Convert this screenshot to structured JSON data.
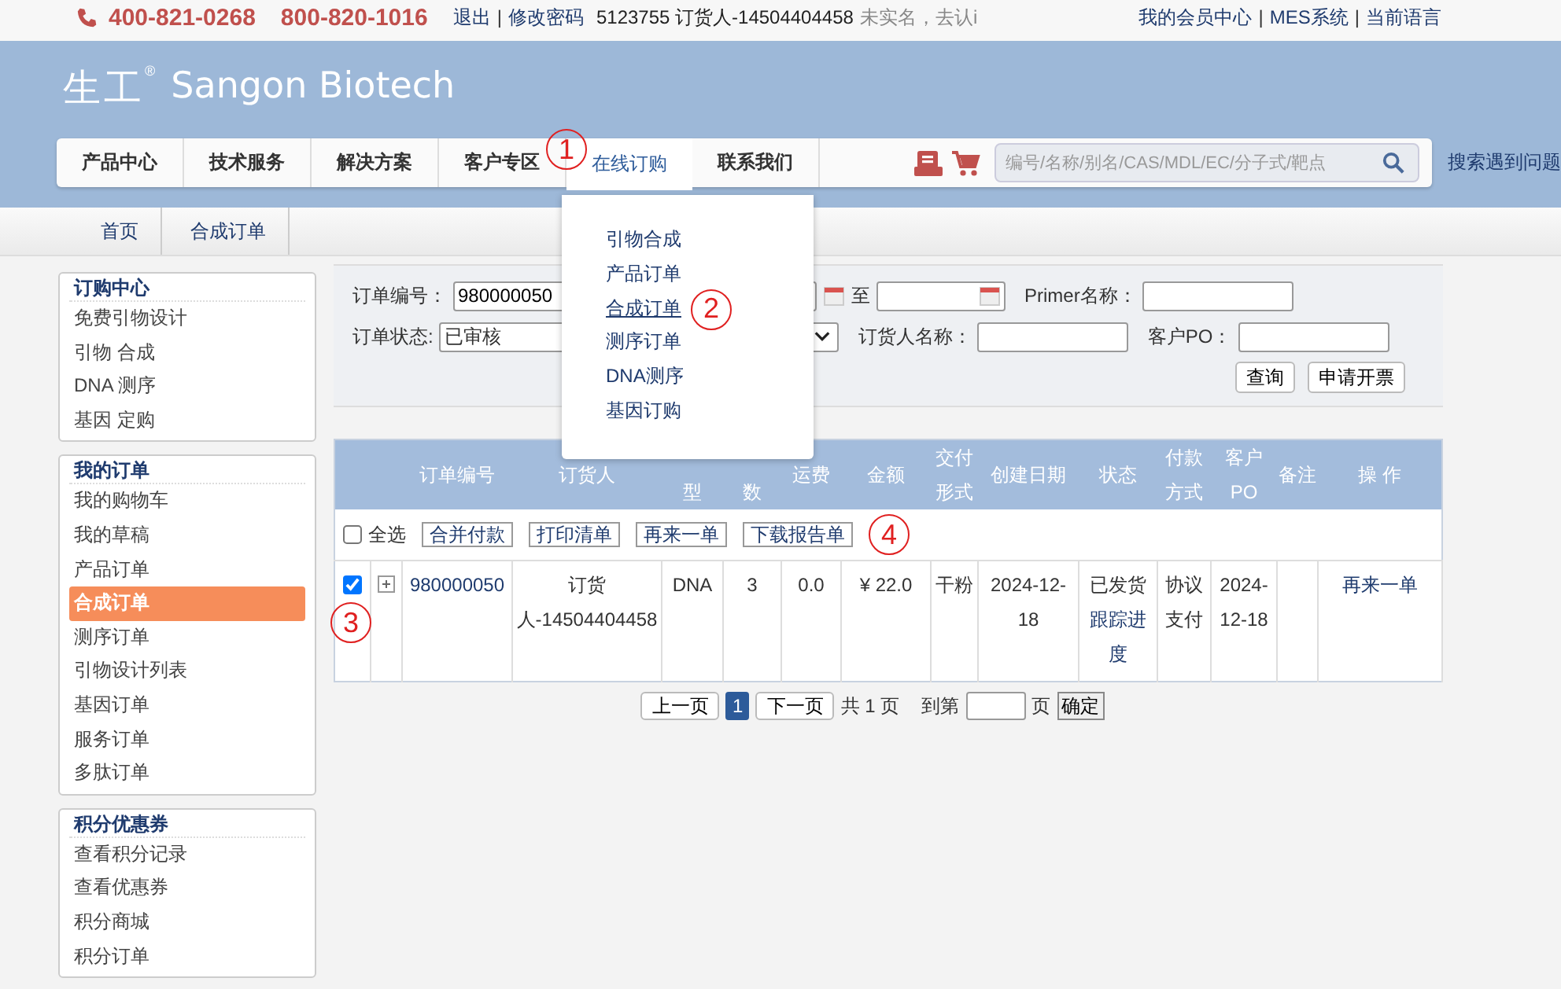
{
  "top_bar": {
    "phones": [
      "400-821-0268",
      "800-820-1016"
    ],
    "links": [
      "退出",
      "修改密码"
    ],
    "account": "5123755 订货人-14504404458",
    "notice": "未实名，去认i",
    "separator": "|",
    "right_links": [
      "我的会员中心",
      "MES系统",
      "当前语言"
    ]
  },
  "logo": {
    "mark": "生工",
    "registered": "®",
    "brand": "Sangon Biotech"
  },
  "nav": {
    "items": [
      {
        "label": "产品中心",
        "selected": false
      },
      {
        "label": "技术服务",
        "selected": false
      },
      {
        "label": "解决方案",
        "selected": false
      },
      {
        "label": "客户专区",
        "selected": false
      },
      {
        "label": "在线订购",
        "selected": true,
        "annotation": "1"
      },
      {
        "label": "联系我们",
        "selected": false
      }
    ],
    "search": {
      "placeholder": "编号/名称/别名/CAS/MDL/EC/分子式/靶点"
    },
    "help_link": "搜索遇到问题"
  },
  "dropdown": {
    "items": [
      {
        "label": "引物合成",
        "selected": false
      },
      {
        "label": "产品订单",
        "selected": false
      },
      {
        "label": "合成订单",
        "selected": true,
        "annotation": "2"
      },
      {
        "label": "测序订单",
        "selected": false
      },
      {
        "label": "DNA测序",
        "selected": false
      },
      {
        "label": "基因订购",
        "selected": false
      }
    ]
  },
  "breadcrumb": [
    "首页",
    "合成订单"
  ],
  "sidebar": {
    "sections": [
      {
        "title": "订购中心",
        "items": [
          {
            "label": "免费引物设计",
            "selected": false
          },
          {
            "label": "引物  合成",
            "selected": false
          },
          {
            "label": "DNA 测序",
            "selected": false
          },
          {
            "label": "基因  定购",
            "selected": false
          }
        ]
      },
      {
        "title": "我的订单",
        "items": [
          {
            "label": "我的购物车",
            "selected": false
          },
          {
            "label": "我的草稿",
            "selected": false
          },
          {
            "label": "产品订单",
            "selected": false
          },
          {
            "label": "合成订单",
            "selected": true
          },
          {
            "label": "测序订单",
            "selected": false
          },
          {
            "label": "引物设计列表",
            "selected": false
          },
          {
            "label": "基因订单",
            "selected": false
          },
          {
            "label": "服务订单",
            "selected": false
          },
          {
            "label": "多肽订单",
            "selected": false
          }
        ]
      },
      {
        "title": "积分优惠券",
        "items": [
          {
            "label": "查看积分记录",
            "selected": false
          },
          {
            "label": "查看优惠券",
            "selected": false
          },
          {
            "label": "积分商城",
            "selected": false
          },
          {
            "label": "积分订单",
            "selected": false
          }
        ]
      }
    ]
  },
  "filters": {
    "order_no": {
      "label": "订单编号：",
      "value": "980000050"
    },
    "date_to": "至",
    "primer": {
      "label": "Primer名称："
    },
    "status": {
      "label": "订单状态:",
      "value": "已审核"
    },
    "orderer": {
      "label": "订货人名称："
    },
    "po": {
      "label": "客户PO："
    },
    "buttons": [
      "查询",
      "申请开票"
    ]
  },
  "table": {
    "columns": [
      "订单编号",
      "订货人",
      "型",
      "数",
      "运费",
      "金额",
      "交付形式",
      "创建日期",
      "状态",
      "付款方式",
      "客户PO",
      "备注",
      "操 作"
    ],
    "toolbar": {
      "select_all": {
        "label": "全选",
        "checked": false
      },
      "buttons": [
        "合并付款",
        "打印清单",
        "再来一单",
        "下载报告单"
      ],
      "annotation": "4"
    },
    "rows": [
      {
        "checked": true,
        "annotation": "3",
        "order_no": "980000050",
        "orderer": "订货人-14504404458",
        "column_3": "DNA",
        "column_4": "3",
        "shipping": "0.0",
        "amount": "¥ 22.0",
        "delivery": "干粉",
        "created": "2024-12-18",
        "status": "已发货",
        "track_link": "跟踪进度",
        "payment": "协议支付",
        "customer_po": "2024-12-18",
        "action": "再来一单"
      }
    ]
  },
  "pagination": {
    "prev": "上一页",
    "pages": [
      {
        "label": "1",
        "selected": true
      }
    ],
    "next": "下一页",
    "total": "共 1 页",
    "goto_label": "到第",
    "page_unit": "页",
    "confirm": "确定"
  }
}
